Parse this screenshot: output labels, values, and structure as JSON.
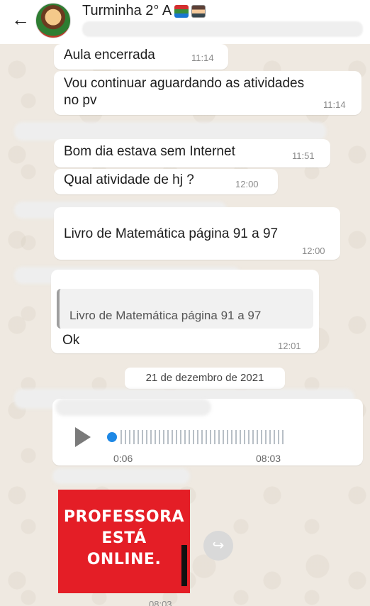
{
  "header": {
    "back_icon": "arrow-left-icon",
    "title": "Turminha 2° A",
    "title_emojis": [
      "books-icon",
      "teacher-icon"
    ]
  },
  "messages": [
    {
      "text": "Aula encerrada",
      "time": "11:14"
    },
    {
      "text": "Vou continuar aguardando as atividades no pv",
      "time": "11:14"
    },
    {
      "text": "Bom dia estava sem Internet",
      "time": "11:51"
    },
    {
      "text": "Qual atividade de hj ?",
      "time": "12:00"
    },
    {
      "text": "Livro de Matemática página 91 a 97",
      "time": "12:00"
    },
    {
      "quoted": "Livro de Matemática página 91 a 97",
      "text": "Ok",
      "time": "12:01"
    }
  ],
  "date_separator": "21 de dezembro de 2021",
  "audio": {
    "duration": "0:06",
    "time": "08:03",
    "play_icon": "play-icon"
  },
  "image_message": {
    "lines": [
      "PROFESSORA",
      "ESTÁ",
      "ONLINE."
    ],
    "time": "08:03",
    "forward_icon": "forward-icon",
    "colors": {
      "background": "#e41e26",
      "text": "#ffffff"
    }
  }
}
